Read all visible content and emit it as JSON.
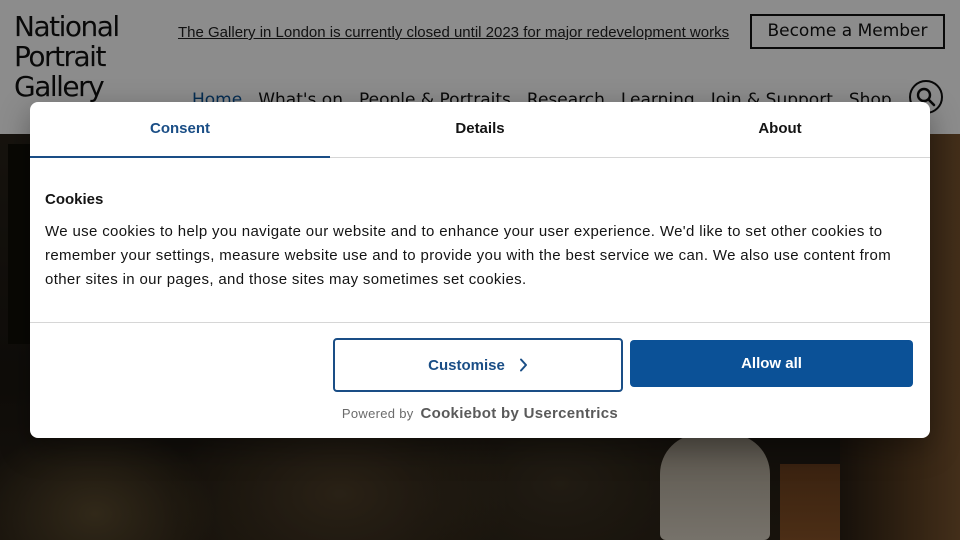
{
  "site": {
    "logo_lines": [
      "National",
      "Portrait",
      "Gallery"
    ],
    "notice": "The Gallery in London is currently closed until 2023 for major redevelopment works",
    "member_button": "Become a Member",
    "nav": [
      "Home",
      "What's on",
      "People & Portraits",
      "Research",
      "Learning",
      "Join & Support",
      "Shop"
    ],
    "search_icon": "search-icon"
  },
  "consent": {
    "tabs": [
      "Consent",
      "Details",
      "About"
    ],
    "active_tab": "Consent",
    "heading": "Cookies",
    "body": "We use cookies to help you navigate our website and to enhance your user experience. We'd like to set other cookies to remember your settings, measure website use and to provide you with the best service we can. We also use content from other sites in our pages, and those sites may sometimes set cookies.",
    "customise_label": "Customise",
    "allow_all_label": "Allow all",
    "powered_by": "Powered by",
    "powered_brand": "Cookiebot by Usercentrics"
  },
  "colors": {
    "accent": "#1a4e86",
    "allow_button": "#0b5197",
    "overlay": "rgba(0,0,0,0.45)"
  }
}
